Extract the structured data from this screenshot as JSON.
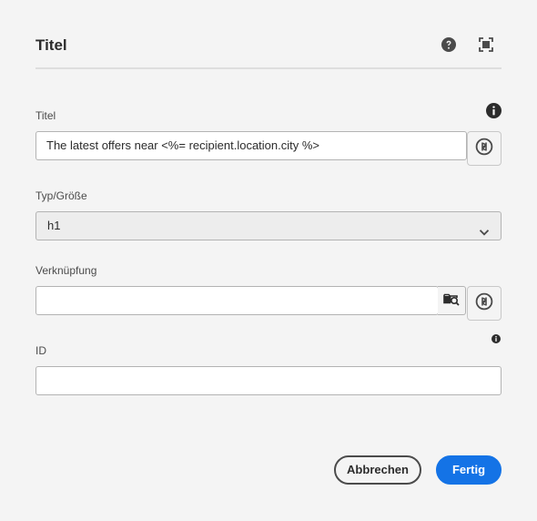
{
  "dialog": {
    "title": "Titel",
    "icons": {
      "help": "help-icon",
      "fullscreen": "fullscreen-icon"
    }
  },
  "fields": {
    "title": {
      "label": "Titel",
      "value": "The latest offers near <%= recipient.location.city %>",
      "icons": [
        "info-icon",
        "personalization-icon"
      ]
    },
    "type_size": {
      "label": "Typ/Größe",
      "selected": "h1",
      "icons": [
        "chevron-down-icon"
      ]
    },
    "link": {
      "label": "Verknüpfung",
      "value": "",
      "icons": [
        "browse-folder-icon",
        "personalization-icon"
      ]
    },
    "id": {
      "label": "ID",
      "value": "",
      "icons": [
        "info-icon"
      ]
    }
  },
  "buttons": {
    "cancel": "Abbrechen",
    "done": "Fertig"
  },
  "colors": {
    "accent": "#1473e6",
    "background": "#f4f4f4"
  }
}
